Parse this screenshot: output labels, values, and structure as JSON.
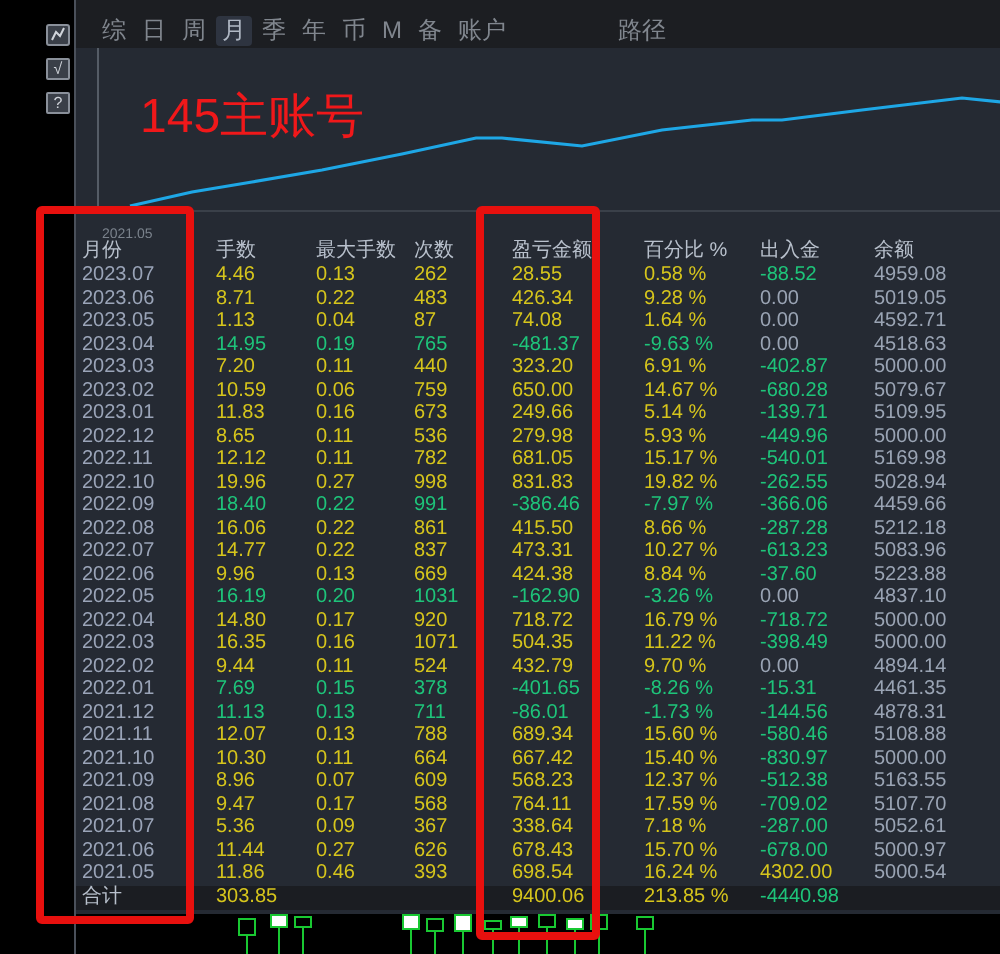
{
  "side_buttons": [
    {
      "kind": "icon"
    },
    {
      "kind": "text",
      "label": "√"
    },
    {
      "kind": "text",
      "label": "?"
    }
  ],
  "tabs": [
    {
      "label": "综",
      "selected": false
    },
    {
      "label": "日",
      "selected": false
    },
    {
      "label": "周",
      "selected": false
    },
    {
      "label": "月",
      "selected": true
    },
    {
      "label": "季",
      "selected": false
    },
    {
      "label": "年",
      "selected": false
    },
    {
      "label": "币",
      "selected": false
    },
    {
      "label": "M",
      "selected": false
    },
    {
      "label": "备",
      "selected": false
    },
    {
      "label": "账户",
      "selected": false
    },
    {
      "label": "路径",
      "selected": false
    }
  ],
  "chart": {
    "account_label": "145主账号",
    "start_label": "2021.05"
  },
  "table": {
    "columns": [
      "月份",
      "手数",
      "最大手数",
      "次数",
      "盈亏金额",
      "百分比 %",
      "出入金",
      "余额"
    ],
    "rows": [
      {
        "month": "2023.07",
        "lots": "4.46",
        "max_lots": "0.13",
        "count": "262",
        "profit": "28.55",
        "pct": "0.58 %",
        "flow": {
          "text": "-88.52",
          "color": "#1ec47a"
        },
        "balance": "4959.08",
        "color": "#d6c51c"
      },
      {
        "month": "2023.06",
        "lots": "8.71",
        "max_lots": "0.22",
        "count": "483",
        "profit": "426.34",
        "pct": "9.28 %",
        "flow": {
          "text": "0.00",
          "color": "#9aa4b4"
        },
        "balance": "5019.05",
        "color": "#d6c51c"
      },
      {
        "month": "2023.05",
        "lots": "1.13",
        "max_lots": "0.04",
        "count": "87",
        "profit": "74.08",
        "pct": "1.64 %",
        "flow": {
          "text": "0.00",
          "color": "#9aa4b4"
        },
        "balance": "4592.71",
        "color": "#d6c51c"
      },
      {
        "month": "2023.04",
        "lots": "14.95",
        "max_lots": "0.19",
        "count": "765",
        "profit": "-481.37",
        "pct": "-9.63 %",
        "flow": {
          "text": "0.00",
          "color": "#9aa4b4"
        },
        "balance": "4518.63",
        "color": "#1ec47a"
      },
      {
        "month": "2023.03",
        "lots": "7.20",
        "max_lots": "0.11",
        "count": "440",
        "profit": "323.20",
        "pct": "6.91 %",
        "flow": {
          "text": "-402.87",
          "color": "#1ec47a"
        },
        "balance": "5000.00",
        "color": "#d6c51c"
      },
      {
        "month": "2023.02",
        "lots": "10.59",
        "max_lots": "0.06",
        "count": "759",
        "profit": "650.00",
        "pct": "14.67 %",
        "flow": {
          "text": "-680.28",
          "color": "#1ec47a"
        },
        "balance": "5079.67",
        "color": "#d6c51c"
      },
      {
        "month": "2023.01",
        "lots": "11.83",
        "max_lots": "0.16",
        "count": "673",
        "profit": "249.66",
        "pct": "5.14 %",
        "flow": {
          "text": "-139.71",
          "color": "#1ec47a"
        },
        "balance": "5109.95",
        "color": "#d6c51c"
      },
      {
        "month": "2022.12",
        "lots": "8.65",
        "max_lots": "0.11",
        "count": "536",
        "profit": "279.98",
        "pct": "5.93 %",
        "flow": {
          "text": "-449.96",
          "color": "#1ec47a"
        },
        "balance": "5000.00",
        "color": "#d6c51c"
      },
      {
        "month": "2022.11",
        "lots": "12.12",
        "max_lots": "0.11",
        "count": "782",
        "profit": "681.05",
        "pct": "15.17 %",
        "flow": {
          "text": "-540.01",
          "color": "#1ec47a"
        },
        "balance": "5169.98",
        "color": "#d6c51c"
      },
      {
        "month": "2022.10",
        "lots": "19.96",
        "max_lots": "0.27",
        "count": "998",
        "profit": "831.83",
        "pct": "19.82 %",
        "flow": {
          "text": "-262.55",
          "color": "#1ec47a"
        },
        "balance": "5028.94",
        "color": "#d6c51c"
      },
      {
        "month": "2022.09",
        "lots": "18.40",
        "max_lots": "0.22",
        "count": "991",
        "profit": "-386.46",
        "pct": "-7.97 %",
        "flow": {
          "text": "-366.06",
          "color": "#1ec47a"
        },
        "balance": "4459.66",
        "color": "#1ec47a"
      },
      {
        "month": "2022.08",
        "lots": "16.06",
        "max_lots": "0.22",
        "count": "861",
        "profit": "415.50",
        "pct": "8.66 %",
        "flow": {
          "text": "-287.28",
          "color": "#1ec47a"
        },
        "balance": "5212.18",
        "color": "#d6c51c"
      },
      {
        "month": "2022.07",
        "lots": "14.77",
        "max_lots": "0.22",
        "count": "837",
        "profit": "473.31",
        "pct": "10.27 %",
        "flow": {
          "text": "-613.23",
          "color": "#1ec47a"
        },
        "balance": "5083.96",
        "color": "#d6c51c"
      },
      {
        "month": "2022.06",
        "lots": "9.96",
        "max_lots": "0.13",
        "count": "669",
        "profit": "424.38",
        "pct": "8.84 %",
        "flow": {
          "text": "-37.60",
          "color": "#1ec47a"
        },
        "balance": "5223.88",
        "color": "#d6c51c"
      },
      {
        "month": "2022.05",
        "lots": "16.19",
        "max_lots": "0.20",
        "count": "1031",
        "profit": "-162.90",
        "pct": "-3.26 %",
        "flow": {
          "text": "0.00",
          "color": "#9aa4b4"
        },
        "balance": "4837.10",
        "color": "#1ec47a"
      },
      {
        "month": "2022.04",
        "lots": "14.80",
        "max_lots": "0.17",
        "count": "920",
        "profit": "718.72",
        "pct": "16.79 %",
        "flow": {
          "text": "-718.72",
          "color": "#1ec47a"
        },
        "balance": "5000.00",
        "color": "#d6c51c"
      },
      {
        "month": "2022.03",
        "lots": "16.35",
        "max_lots": "0.16",
        "count": "1071",
        "profit": "504.35",
        "pct": "11.22 %",
        "flow": {
          "text": "-398.49",
          "color": "#1ec47a"
        },
        "balance": "5000.00",
        "color": "#d6c51c"
      },
      {
        "month": "2022.02",
        "lots": "9.44",
        "max_lots": "0.11",
        "count": "524",
        "profit": "432.79",
        "pct": "9.70 %",
        "flow": {
          "text": "0.00",
          "color": "#9aa4b4"
        },
        "balance": "4894.14",
        "color": "#d6c51c"
      },
      {
        "month": "2022.01",
        "lots": "7.69",
        "max_lots": "0.15",
        "count": "378",
        "profit": "-401.65",
        "pct": "-8.26 %",
        "flow": {
          "text": "-15.31",
          "color": "#1ec47a"
        },
        "balance": "4461.35",
        "color": "#1ec47a"
      },
      {
        "month": "2021.12",
        "lots": "11.13",
        "max_lots": "0.13",
        "count": "711",
        "profit": "-86.01",
        "pct": "-1.73 %",
        "flow": {
          "text": "-144.56",
          "color": "#1ec47a"
        },
        "balance": "4878.31",
        "color": "#1ec47a"
      },
      {
        "month": "2021.11",
        "lots": "12.07",
        "max_lots": "0.13",
        "count": "788",
        "profit": "689.34",
        "pct": "15.60 %",
        "flow": {
          "text": "-580.46",
          "color": "#1ec47a"
        },
        "balance": "5108.88",
        "color": "#d6c51c"
      },
      {
        "month": "2021.10",
        "lots": "10.30",
        "max_lots": "0.11",
        "count": "664",
        "profit": "667.42",
        "pct": "15.40 %",
        "flow": {
          "text": "-830.97",
          "color": "#1ec47a"
        },
        "balance": "5000.00",
        "color": "#d6c51c"
      },
      {
        "month": "2021.09",
        "lots": "8.96",
        "max_lots": "0.07",
        "count": "609",
        "profit": "568.23",
        "pct": "12.37 %",
        "flow": {
          "text": "-512.38",
          "color": "#1ec47a"
        },
        "balance": "5163.55",
        "color": "#d6c51c"
      },
      {
        "month": "2021.08",
        "lots": "9.47",
        "max_lots": "0.17",
        "count": "568",
        "profit": "764.11",
        "pct": "17.59 %",
        "flow": {
          "text": "-709.02",
          "color": "#1ec47a"
        },
        "balance": "5107.70",
        "color": "#d6c51c"
      },
      {
        "month": "2021.07",
        "lots": "5.36",
        "max_lots": "0.09",
        "count": "367",
        "profit": "338.64",
        "pct": "7.18 %",
        "flow": {
          "text": "-287.00",
          "color": "#1ec47a"
        },
        "balance": "5052.61",
        "color": "#d6c51c"
      },
      {
        "month": "2021.06",
        "lots": "11.44",
        "max_lots": "0.27",
        "count": "626",
        "profit": "678.43",
        "pct": "15.70 %",
        "flow": {
          "text": "-678.00",
          "color": "#1ec47a"
        },
        "balance": "5000.97",
        "color": "#d6c51c"
      },
      {
        "month": "2021.05",
        "lots": "11.86",
        "max_lots": "0.46",
        "count": "393",
        "profit": "698.54",
        "pct": "16.24 %",
        "flow": {
          "text": "4302.00",
          "color": "#d6c51c"
        },
        "balance": "5000.54",
        "color": "#d6c51c"
      }
    ],
    "total": {
      "label": "合计",
      "lots": "303.85",
      "profit": "9400.06",
      "pct": "213.85 %",
      "flow": {
        "text": "-4440.98",
        "color": "#1ec47a"
      },
      "color": "#d6c51c"
    }
  }
}
